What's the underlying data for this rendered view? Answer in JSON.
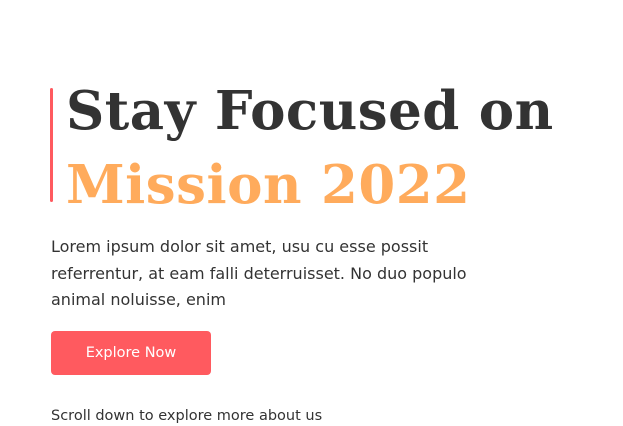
{
  "hero": {
    "headline_line1": "Stay Focused on",
    "headline_line2": "Mission 2022",
    "description": "Lorem ipsum dolor sit amet, usu cu esse possit referrentur, at eam falli deterruisset. No duo populo animal noluisse, enim",
    "cta_label": "Explore Now",
    "scroll_hint": "Scroll down to explore more about us"
  },
  "colors": {
    "accent": "#ff5a5f",
    "highlight": "#ffab5c",
    "text": "#333333",
    "background": "#ffffff"
  }
}
